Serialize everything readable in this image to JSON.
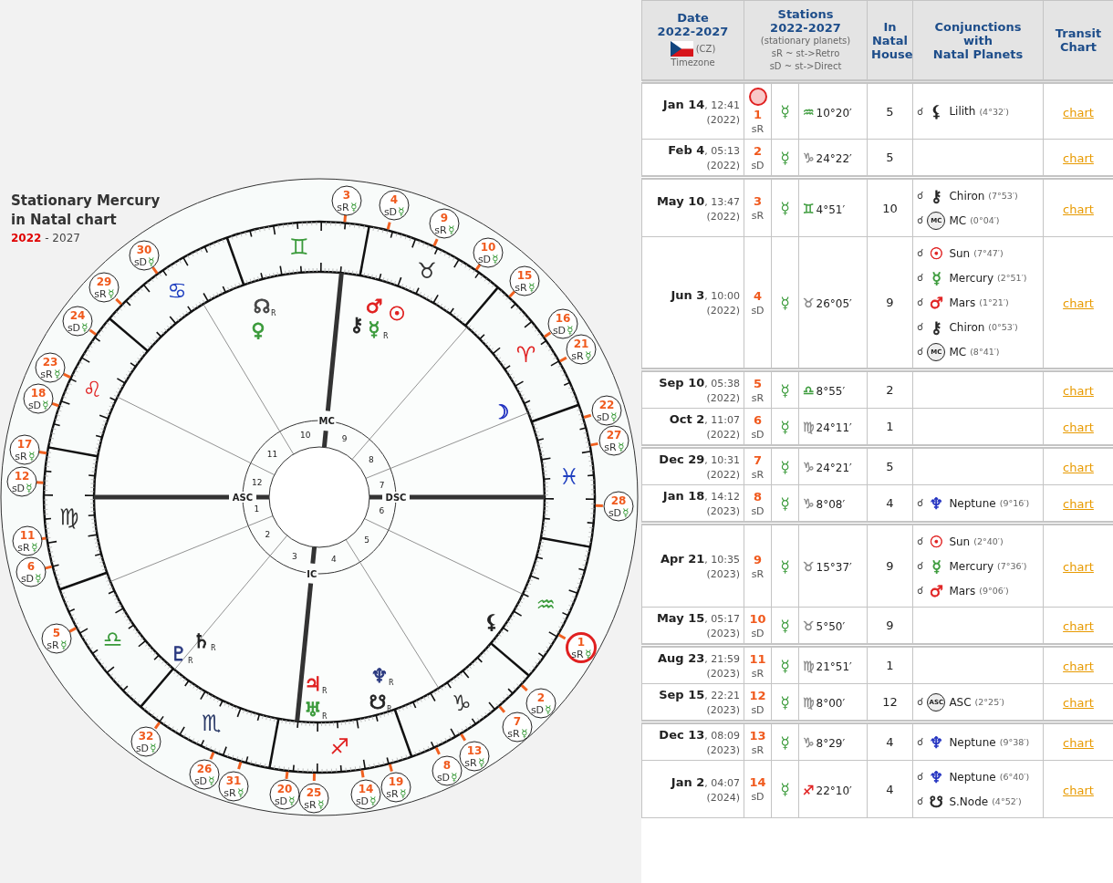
{
  "chart": {
    "title": "Stationary Mercury\nin Natal chart",
    "range_start": "2022",
    "range_rest": " - 2027",
    "signs": [
      {
        "glyph": "♈",
        "color": "#e02020"
      },
      {
        "glyph": "♉",
        "color": "#333333"
      },
      {
        "glyph": "♊",
        "color": "#3a9a3a"
      },
      {
        "glyph": "♋",
        "color": "#2040c0"
      },
      {
        "glyph": "♌",
        "color": "#e02020"
      },
      {
        "glyph": "♍",
        "color": "#333333"
      },
      {
        "glyph": "♎",
        "color": "#3a9a3a"
      },
      {
        "glyph": "♏",
        "color": "#2b3a67"
      },
      {
        "glyph": "♐",
        "color": "#e02020"
      },
      {
        "glyph": "♑",
        "color": "#333333"
      },
      {
        "glyph": "♒",
        "color": "#3a9a3a"
      },
      {
        "glyph": "♓",
        "color": "#2040c0"
      }
    ],
    "houses": [
      "1",
      "2",
      "3",
      "4",
      "5",
      "6",
      "7",
      "8",
      "9",
      "10",
      "11",
      "12"
    ],
    "axes": [
      "ASC",
      "IC",
      "DSC",
      "MC"
    ],
    "planets": [
      {
        "glyph": "☊",
        "color": "#444444",
        "retro": "R"
      },
      {
        "glyph": "♀",
        "color": "#3a9a3a"
      },
      {
        "glyph": "⚷",
        "color": "#222222"
      },
      {
        "glyph": "♂",
        "color": "#e02020"
      },
      {
        "glyph": "☉",
        "color": "#e02020"
      },
      {
        "glyph": "☿",
        "color": "#3a9a3a",
        "retro": "R"
      },
      {
        "glyph": "☽",
        "color": "#2030c0"
      },
      {
        "glyph": "⚸",
        "color": "#222222"
      },
      {
        "glyph": "♇",
        "color": "#2b3a80",
        "retro": "R"
      },
      {
        "glyph": "♄",
        "color": "#222222",
        "retro": "R"
      },
      {
        "glyph": "♃",
        "color": "#e02020",
        "retro": "R"
      },
      {
        "glyph": "♅",
        "color": "#3a9a3a",
        "retro": "R"
      },
      {
        "glyph": "♆",
        "color": "#2b3a80",
        "retro": "R"
      },
      {
        "glyph": "☋",
        "color": "#222222",
        "retro": "R"
      }
    ],
    "stations": [
      {
        "number": "3",
        "motion": "sR",
        "planet": "☿",
        "highlighted": false
      },
      {
        "number": "4",
        "motion": "sD",
        "planet": "☿",
        "highlighted": false
      },
      {
        "number": "9",
        "motion": "sR",
        "planet": "☿",
        "highlighted": false
      },
      {
        "number": "10",
        "motion": "sD",
        "planet": "☿",
        "highlighted": false
      },
      {
        "number": "30",
        "motion": "sD",
        "planet": "☿",
        "highlighted": false
      },
      {
        "number": "15",
        "motion": "sR",
        "planet": "☿",
        "highlighted": false
      },
      {
        "number": "29",
        "motion": "sR",
        "planet": "☿",
        "highlighted": false
      },
      {
        "number": "24",
        "motion": "sD",
        "planet": "☿",
        "highlighted": false
      },
      {
        "number": "16",
        "motion": "sD",
        "planet": "☿",
        "highlighted": false
      },
      {
        "number": "21",
        "motion": "sR",
        "planet": "☿",
        "highlighted": false
      },
      {
        "number": "23",
        "motion": "sR",
        "planet": "☿",
        "highlighted": false
      },
      {
        "number": "18",
        "motion": "sD",
        "planet": "☿",
        "highlighted": false
      },
      {
        "number": "22",
        "motion": "sD",
        "planet": "☿",
        "highlighted": false
      },
      {
        "number": "27",
        "motion": "sR",
        "planet": "☿",
        "highlighted": false
      },
      {
        "number": "17",
        "motion": "sR",
        "planet": "☿",
        "highlighted": false
      },
      {
        "number": "12",
        "motion": "sD",
        "planet": "☿",
        "highlighted": false
      },
      {
        "number": "28",
        "motion": "sD",
        "planet": "☿",
        "highlighted": false
      },
      {
        "number": "11",
        "motion": "sR",
        "planet": "☿",
        "highlighted": false
      },
      {
        "number": "6",
        "motion": "sD",
        "planet": "☿",
        "highlighted": false
      },
      {
        "number": "5",
        "motion": "sR",
        "planet": "☿",
        "highlighted": false
      },
      {
        "number": "1",
        "motion": "sR",
        "planet": "☿",
        "highlighted": true
      },
      {
        "number": "2",
        "motion": "sD",
        "planet": "☿",
        "highlighted": false
      },
      {
        "number": "7",
        "motion": "sR",
        "planet": "☿",
        "highlighted": false
      },
      {
        "number": "32",
        "motion": "sD",
        "planet": "☿",
        "highlighted": false
      },
      {
        "number": "13",
        "motion": "sR",
        "planet": "☿",
        "highlighted": false
      },
      {
        "number": "8",
        "motion": "sD",
        "planet": "☿",
        "highlighted": false
      },
      {
        "number": "26",
        "motion": "sD",
        "planet": "☿",
        "highlighted": false
      },
      {
        "number": "31",
        "motion": "sR",
        "planet": "☿",
        "highlighted": false
      },
      {
        "number": "19",
        "motion": "sR",
        "planet": "☿",
        "highlighted": false
      },
      {
        "number": "20",
        "motion": "sD",
        "planet": "☿",
        "highlighted": false
      },
      {
        "number": "25",
        "motion": "sR",
        "planet": "☿",
        "highlighted": false
      },
      {
        "number": "14",
        "motion": "sD",
        "planet": "☿",
        "highlighted": false
      }
    ]
  },
  "table": {
    "header": {
      "date": "Date\n2022-2027",
      "country": "(CZ)",
      "timezone": "Timezone",
      "stations": "Stations\n2022-2027",
      "stations_note": "(stationary planets)",
      "legend": [
        "sR ~ st->Retro",
        "sD ~ st->Direct"
      ],
      "house": "In\nNatal\nHouse",
      "conjunctions": "Conjunctions\nwith\nNatal Planets",
      "transit": "Transit\nChart"
    },
    "groups": [
      {
        "rows": [
          {
            "date": "**Jan 14**, 12:41",
            "year": "(2022)",
            "number": "1",
            "motion": "sR",
            "highlighted": true,
            "planet": "☿",
            "sign": {
              "glyph": "♒",
              "color": "#3a9a3a"
            },
            "degree": "10°20′",
            "house": "5",
            "conjunctions": [
              {
                "aspect": "☌",
                "kind": "planet",
                "glyph": "⚸",
                "color": "#222222",
                "name": "Lilith",
                "orb": "(4°32′)"
              }
            ],
            "link": "chart"
          },
          {
            "date": "**Feb 4**, 05:13",
            "year": "(2022)",
            "number": "2",
            "motion": "sD",
            "highlighted": false,
            "planet": "☿",
            "sign": {
              "glyph": "♑",
              "color": "#888888"
            },
            "degree": "24°22′",
            "house": "5",
            "link": "chart"
          }
        ]
      },
      {
        "rows": [
          {
            "date": "**May 10**, 13:47",
            "year": "(2022)",
            "number": "3",
            "motion": "sR",
            "highlighted": false,
            "planet": "☿",
            "sign": {
              "glyph": "♊",
              "color": "#3a9a3a"
            },
            "degree": "4°51′",
            "house": "10",
            "conjunctions": [
              {
                "aspect": "☌",
                "kind": "planet",
                "glyph": "⚷",
                "color": "#222222",
                "name": "Chiron",
                "orb": "(7°53′)"
              },
              {
                "aspect": "☌",
                "kind": "angle",
                "glyph": "MC",
                "color": "#222222",
                "name": "MC",
                "orb": "(0°04′)"
              }
            ],
            "link": "chart"
          },
          {
            "date": "**Jun 3**, 10:00",
            "year": "(2022)",
            "number": "4",
            "motion": "sD",
            "highlighted": false,
            "planet": "☿",
            "sign": {
              "glyph": "♉",
              "color": "#888888"
            },
            "degree": "26°05′",
            "house": "9",
            "conjunctions": [
              {
                "aspect": "☌",
                "kind": "planet",
                "glyph": "☉",
                "color": "#e02020",
                "name": "Sun",
                "orb": "(7°47′)"
              },
              {
                "aspect": "☌",
                "kind": "planet",
                "glyph": "☿",
                "color": "#3a9a3a",
                "name": "Mercury",
                "orb": "(2°51′)"
              },
              {
                "aspect": "☌",
                "kind": "planet",
                "glyph": "♂",
                "color": "#e02020",
                "name": "Mars",
                "orb": "(1°21′)"
              },
              {
                "aspect": "☌",
                "kind": "planet",
                "glyph": "⚷",
                "color": "#222222",
                "name": "Chiron",
                "orb": "(0°53′)"
              },
              {
                "aspect": "☌",
                "kind": "angle",
                "glyph": "MC",
                "color": "#222222",
                "name": "MC",
                "orb": "(8°41′)"
              }
            ],
            "link": "chart"
          }
        ]
      },
      {
        "rows": [
          {
            "date": "**Sep 10**, 05:38",
            "year": "(2022)",
            "number": "5",
            "motion": "sR",
            "highlighted": false,
            "planet": "☿",
            "sign": {
              "glyph": "♎",
              "color": "#3a9a3a"
            },
            "degree": "8°55′",
            "house": "2",
            "link": "chart"
          },
          {
            "date": "**Oct 2**, 11:07",
            "year": "(2022)",
            "number": "6",
            "motion": "sD",
            "highlighted": false,
            "planet": "☿",
            "sign": {
              "glyph": "♍",
              "color": "#888888"
            },
            "degree": "24°11′",
            "house": "1",
            "link": "chart"
          }
        ]
      },
      {
        "rows": [
          {
            "date": "**Dec 29**, 10:31",
            "year": "(2022)",
            "number": "7",
            "motion": "sR",
            "highlighted": false,
            "planet": "☿",
            "sign": {
              "glyph": "♑",
              "color": "#888888"
            },
            "degree": "24°21′",
            "house": "5",
            "link": "chart"
          },
          {
            "date": "**Jan 18**, 14:12",
            "year": "(2023)",
            "number": "8",
            "motion": "sD",
            "highlighted": false,
            "planet": "☿",
            "sign": {
              "glyph": "♑",
              "color": "#888888"
            },
            "degree": "8°08′",
            "house": "4",
            "conjunctions": [
              {
                "aspect": "☌",
                "kind": "planet",
                "glyph": "♆",
                "color": "#2030c0",
                "name": "Neptune",
                "orb": "(9°16′)"
              }
            ],
            "link": "chart"
          }
        ]
      },
      {
        "rows": [
          {
            "date": "**Apr 21**, 10:35",
            "year": "(2023)",
            "number": "9",
            "motion": "sR",
            "highlighted": false,
            "planet": "☿",
            "sign": {
              "glyph": "♉",
              "color": "#888888"
            },
            "degree": "15°37′",
            "house": "9",
            "conjunctions": [
              {
                "aspect": "☌",
                "kind": "planet",
                "glyph": "☉",
                "color": "#e02020",
                "name": "Sun",
                "orb": "(2°40′)"
              },
              {
                "aspect": "☌",
                "kind": "planet",
                "glyph": "☿",
                "color": "#3a9a3a",
                "name": "Mercury",
                "orb": "(7°36′)"
              },
              {
                "aspect": "☌",
                "kind": "planet",
                "glyph": "♂",
                "color": "#e02020",
                "name": "Mars",
                "orb": "(9°06′)"
              }
            ],
            "link": "chart"
          },
          {
            "date": "**May 15**, 05:17",
            "year": "(2023)",
            "number": "10",
            "motion": "sD",
            "highlighted": false,
            "planet": "☿",
            "sign": {
              "glyph": "♉",
              "color": "#888888"
            },
            "degree": "5°50′",
            "house": "9",
            "link": "chart"
          }
        ]
      },
      {
        "rows": [
          {
            "date": "**Aug 23**, 21:59",
            "year": "(2023)",
            "number": "11",
            "motion": "sR",
            "highlighted": false,
            "planet": "☿",
            "sign": {
              "glyph": "♍",
              "color": "#888888"
            },
            "degree": "21°51′",
            "house": "1",
            "link": "chart"
          },
          {
            "date": "**Sep 15**, 22:21",
            "year": "(2023)",
            "number": "12",
            "motion": "sD",
            "highlighted": false,
            "planet": "☿",
            "sign": {
              "glyph": "♍",
              "color": "#888888"
            },
            "degree": "8°00′",
            "house": "12",
            "conjunctions": [
              {
                "aspect": "☌",
                "kind": "angle",
                "glyph": "ASC",
                "color": "#222222",
                "name": "ASC",
                "orb": "(2°25′)"
              }
            ],
            "link": "chart"
          }
        ]
      },
      {
        "rows": [
          {
            "date": "**Dec 13**, 08:09",
            "year": "(2023)",
            "number": "13",
            "motion": "sR",
            "highlighted": false,
            "planet": "☿",
            "sign": {
              "glyph": "♑",
              "color": "#888888"
            },
            "degree": "8°29′",
            "house": "4",
            "conjunctions": [
              {
                "aspect": "☌",
                "kind": "planet",
                "glyph": "♆",
                "color": "#2030c0",
                "name": "Neptune",
                "orb": "(9°38′)"
              }
            ],
            "link": "chart"
          },
          {
            "date": "**Jan 2**, 04:07",
            "year": "(2024)",
            "number": "14",
            "motion": "sD",
            "highlighted": false,
            "planet": "☿",
            "sign": {
              "glyph": "♐",
              "color": "#e02020"
            },
            "degree": "22°10′",
            "house": "4",
            "conjunctions": [
              {
                "aspect": "☌",
                "kind": "planet",
                "glyph": "♆",
                "color": "#2030c0",
                "name": "Neptune",
                "orb": "(6°40′)"
              },
              {
                "aspect": "☌",
                "kind": "planet",
                "glyph": "☋",
                "color": "#222222",
                "name": "S.Node",
                "orb": "(4°52′)"
              }
            ],
            "link": "chart"
          }
        ]
      }
    ]
  }
}
